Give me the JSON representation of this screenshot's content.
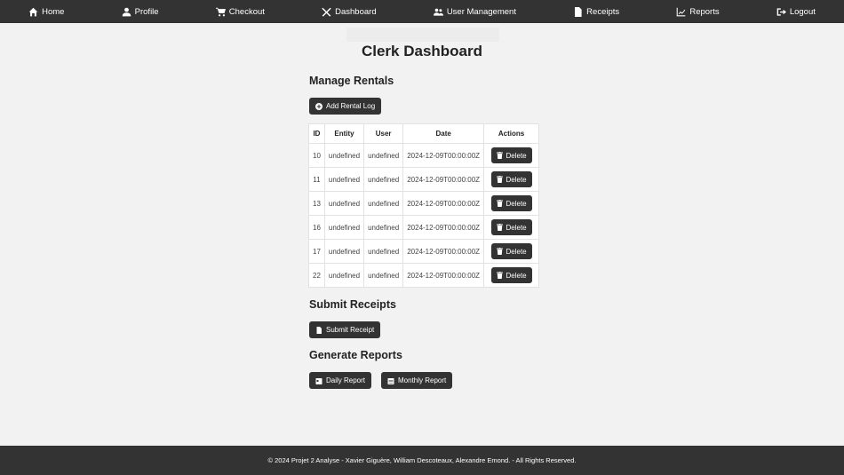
{
  "nav": {
    "items": [
      {
        "label": "Home",
        "icon": "home-icon"
      },
      {
        "label": "Profile",
        "icon": "user-icon"
      },
      {
        "label": "Checkout",
        "icon": "cart-icon"
      },
      {
        "label": "Dashboard",
        "icon": "tools-icon"
      },
      {
        "label": "User Management",
        "icon": "users-icon"
      },
      {
        "label": "Receipts",
        "icon": "file-invoice-icon"
      },
      {
        "label": "Reports",
        "icon": "chart-line-icon"
      },
      {
        "label": "Logout",
        "icon": "sign-out-icon"
      }
    ]
  },
  "page": {
    "title": "Clerk Dashboard"
  },
  "rentals": {
    "heading": "Manage Rentals",
    "add_label": "Add Rental Log",
    "columns": [
      "ID",
      "Entity",
      "User",
      "Date",
      "Actions"
    ],
    "rows": [
      {
        "id": "10",
        "entity": "undefined",
        "user": "undefined",
        "date": "2024-12-09T00:00:00Z",
        "action": "Delete"
      },
      {
        "id": "11",
        "entity": "undefined",
        "user": "undefined",
        "date": "2024-12-09T00:00:00Z",
        "action": "Delete"
      },
      {
        "id": "13",
        "entity": "undefined",
        "user": "undefined",
        "date": "2024-12-09T00:00:00Z",
        "action": "Delete"
      },
      {
        "id": "16",
        "entity": "undefined",
        "user": "undefined",
        "date": "2024-12-09T00:00:00Z",
        "action": "Delete"
      },
      {
        "id": "17",
        "entity": "undefined",
        "user": "undefined",
        "date": "2024-12-09T00:00:00Z",
        "action": "Delete"
      },
      {
        "id": "22",
        "entity": "undefined",
        "user": "undefined",
        "date": "2024-12-09T00:00:00Z",
        "action": "Delete"
      }
    ]
  },
  "receipts": {
    "heading": "Submit Receipts",
    "submit_label": "Submit Receipt"
  },
  "reports": {
    "heading": "Generate Reports",
    "daily_label": "Daily Report",
    "monthly_label": "Monthly Report"
  },
  "footer": {
    "text": "© 2024 Projet 2 Analyse - Xavier Giguère, William Descoteaux, Alexandre Emond. - All Rights Reserved."
  },
  "colors": {
    "nav_bg": "#333333",
    "page_bg": "#f2f2f2",
    "button_bg": "#333333"
  }
}
